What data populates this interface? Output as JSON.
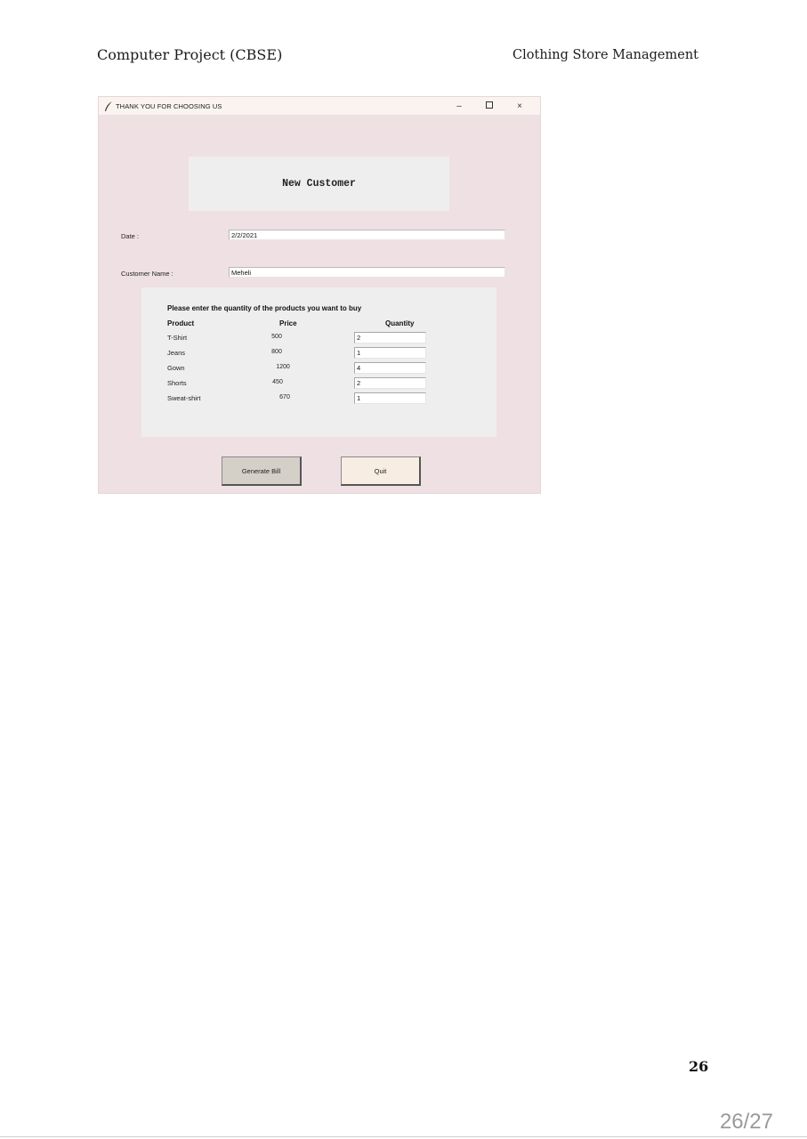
{
  "document": {
    "header_left": "Computer Project (CBSE)",
    "header_right": "Clothing Store Management",
    "page_number": "26",
    "viewer_page_counter": "26/27"
  },
  "window": {
    "title": "THANK YOU FOR CHOOSING US",
    "controls": {
      "minimize": "–",
      "close": "×"
    },
    "banner_title": "New Customer",
    "date_label": "Date :",
    "date_value": "2/2/2021",
    "customer_name_label": "Customer Name :",
    "customer_name_value": "Meheli",
    "products_frame": {
      "heading": "Please enter the quantity of the products you want to buy",
      "columns": {
        "product": "Product",
        "price": "Price",
        "quantity": "Quantity"
      },
      "rows": [
        {
          "product": "T-Shirt",
          "price": "500",
          "quantity": "2"
        },
        {
          "product": "Jeans",
          "price": "800",
          "quantity": "1"
        },
        {
          "product": "Gown",
          "price": "1200",
          "quantity": "4"
        },
        {
          "product": "Shorts",
          "price": "450",
          "quantity": "2"
        },
        {
          "product": "Sweat-shirt",
          "price": "670",
          "quantity": "1"
        }
      ]
    },
    "buttons": {
      "generate_bill": "Generate Bill",
      "quit": "Quit"
    }
  },
  "colors": {
    "window_background": "#efe0e4",
    "titlebar": "#faf3f0",
    "frame_background": "#efeeee",
    "generate_button": "#d4d0c8",
    "quit_button": "#f8ede2"
  },
  "icons": {
    "window_icon": "feather-icon",
    "maximize": "maximize-icon"
  }
}
